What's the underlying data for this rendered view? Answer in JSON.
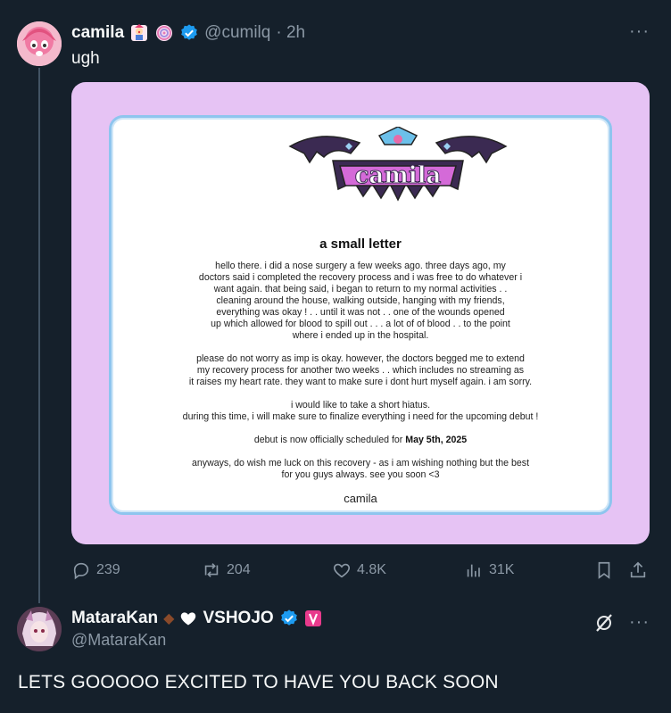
{
  "post": {
    "author_name": "camila",
    "author_handle": "@cumilq",
    "time": "· 2h",
    "text": "ugh",
    "badges": [
      "circus-clown-badge",
      "lollipop-badge",
      "verified-badge"
    ],
    "more_label": "···",
    "image": {
      "logo_text": "camila",
      "letter_title": "a small letter",
      "paragraphs": [
        "hello there. i did a nose surgery a few weeks ago. three days ago, my\ndoctors said i completed the recovery process and i was free to do whatever i\nwant again. that being said, i began to return to my normal activities . .\ncleaning around the house, walking outside, hanging with my friends,\neverything was okay ! . . until it was not . . one of the wounds opened\nup which allowed for blood to spill out . . . a lot of of blood . . to the point\nwhere i ended up in the hospital.",
        "please do not worry as imp is okay. however, the doctors begged me to extend\nmy recovery process for another two weeks . . which includes no streaming as\nit raises my heart rate. they want to make sure i dont hurt myself again. i am sorry.",
        "i would like to take a short hiatus.\nduring this time, i will make sure to finalize everything i need for the upcoming debut !",
        "anyways, do wish me luck on this recovery - as i am wishing nothing but the best\nfor you guys always. see you soon <3"
      ],
      "debut_prefix": "debut is now officially scheduled for ",
      "debut_date": "May 5th, 2025",
      "signature": "camila"
    },
    "stats": {
      "replies": "239",
      "reposts": "204",
      "likes": "4.8K",
      "views": "31K"
    }
  },
  "reply": {
    "author_name": "MataraKan",
    "name_suffix": "VSHOJO",
    "author_handle": "@MataraKan",
    "text": "LETS GOOOOO EXCITED TO HAVE YOU BACK SOON",
    "more_label": "···"
  },
  "colors": {
    "background": "#15202b",
    "media_bg": "#e6c3f4",
    "frame_border": "#8ec5ee",
    "verified": "#1d9bf0",
    "secondary_text": "#8b98a5"
  }
}
